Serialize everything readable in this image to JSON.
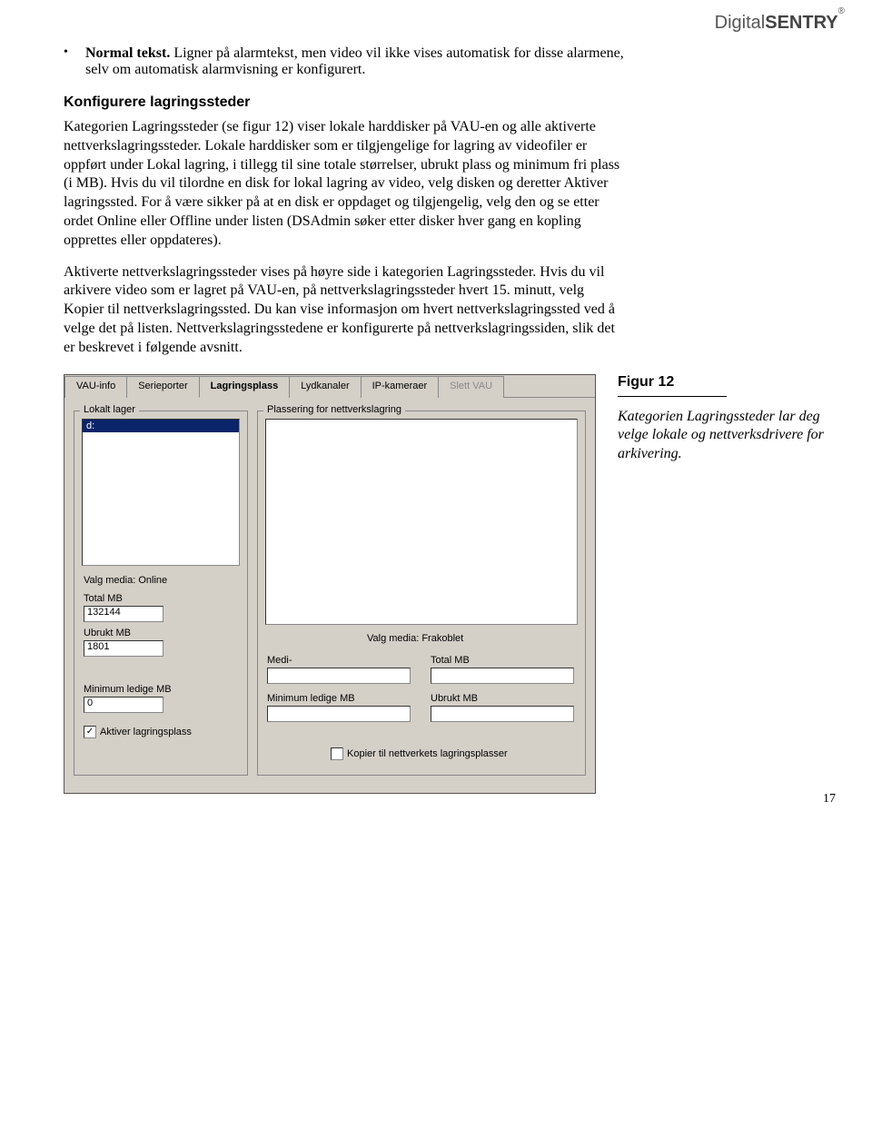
{
  "brand": {
    "part1": "Digital",
    "part2": "SENTRY",
    "reg": "®"
  },
  "bullet": {
    "lead": "Normal tekst.",
    "rest": " Ligner på alarmtekst, men video vil ikke vises automatisk for disse alarmene, selv om automatisk alarmvisning er konfigurert."
  },
  "section_heading": "Konfigurere lagringssteder",
  "para1": "Kategorien Lagringssteder (se figur 12) viser lokale harddisker på VAU-en og alle aktiverte nettverkslagringssteder. Lokale harddisker som er tilgjengelige for lagring av videofiler er oppført under Lokal lagring, i tillegg til sine totale størrelser, ubrukt plass og minimum fri plass (i MB). Hvis du vil tilordne en disk for lokal lagring av video, velg disken og deretter Aktiver lagringssted. For å være sikker på at en disk er oppdaget og tilgjengelig, velg den og se etter ordet Online eller Offline under listen (DSAdmin søker etter disker hver gang en kopling opprettes eller oppdateres).",
  "para2": "Aktiverte nettverkslagringssteder vises på høyre side i kategorien Lagringssteder. Hvis du vil arkivere video som er lagret på VAU-en, på nettverkslagringssteder hvert 15. minutt, velg Kopier til nettverkslagringssted. Du kan vise informasjon om hvert nettverkslagringssted ved å velge det på listen. Nettverkslagringsstedene er konfigurerte på nettverkslagringssiden, slik det er beskrevet i følgende avsnitt.",
  "tabs": {
    "t0": "VAU-info",
    "t1": "Serieporter",
    "t2": "Lagringsplass",
    "t3": "Lydkanaler",
    "t4": "IP-kameraer",
    "t5": "Slett VAU"
  },
  "local_group": {
    "legend": "Lokalt lager",
    "drive": "d:",
    "media_label": "Valg media: Online",
    "total_label": "Total MB",
    "total_value": "132144",
    "unused_label": "Ubrukt MB",
    "unused_value": "1801",
    "minfree_label": "Minimum ledige MB",
    "minfree_value": "0",
    "activate_label": "Aktiver lagringsplass"
  },
  "net_group": {
    "legend": "Plassering for nettverkslagring",
    "media_label": "Valg media: Frakoblet",
    "media_col": "Medi-",
    "total_col": "Total MB",
    "minfree_label": "Minimum ledige MB",
    "unused_label": "Ubrukt MB",
    "copy_label": "Kopier til nettverkets lagringsplasser"
  },
  "caption": {
    "title": "Figur 12",
    "text": "Kategorien Lagringssteder lar deg velge lokale og nettverksdrivere for arkivering."
  },
  "page_number": "17"
}
